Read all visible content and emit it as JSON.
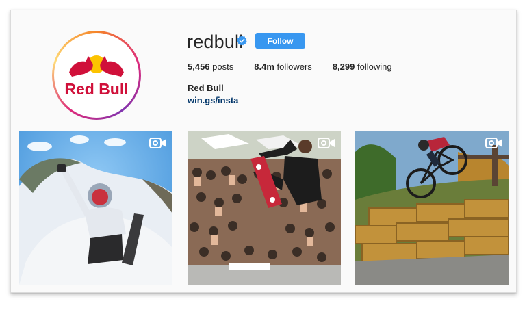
{
  "profile": {
    "username": "redbull",
    "verified": true,
    "follow_label": "Follow",
    "stats": {
      "posts_value": "5,456",
      "posts_label": "posts",
      "followers_value": "8.4m",
      "followers_label": "followers",
      "following_value": "8,299",
      "following_label": "following"
    },
    "full_name": "Red Bull",
    "website": "win.gs/insta",
    "logo_text": "Red Bull"
  },
  "posts": [
    {
      "type": "video",
      "icon": "video-camera-icon",
      "subject": "snowboarder"
    },
    {
      "type": "video",
      "icon": "video-camera-icon",
      "subject": "skateboarder"
    },
    {
      "type": "video",
      "icon": "video-camera-icon",
      "subject": "bmx-rider"
    }
  ],
  "colors": {
    "follow_button": "#3897f0",
    "link": "#003569",
    "verified_badge": "#3897f0",
    "logo_red": "#d0103a",
    "logo_yellow": "#fcc300"
  }
}
